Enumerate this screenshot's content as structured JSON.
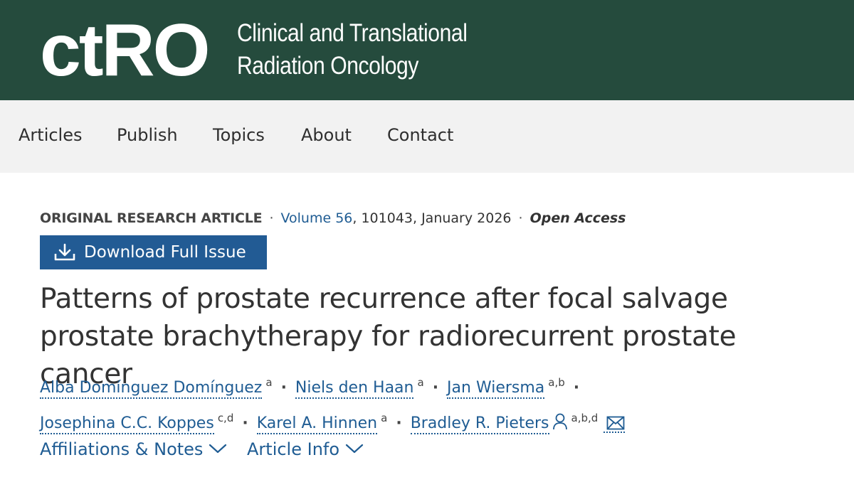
{
  "masthead": {
    "logo": "ctRO",
    "journal_line1": "Clinical and Translational",
    "journal_line2": "Radiation Oncology"
  },
  "nav": {
    "items": [
      "Articles",
      "Publish",
      "Topics",
      "About",
      "Contact"
    ]
  },
  "meta": {
    "article_type": "ORIGINAL RESEARCH ARTICLE",
    "volume_link": "Volume 56",
    "volume_rest": ", 101043, January 2026",
    "access": "Open Access",
    "separator": "·"
  },
  "download": {
    "label": "Download Full Issue",
    "icon": "download-icon"
  },
  "article": {
    "title": "Patterns of prostate recurrence after focal salvage prostate brachytherapy for radiorecurrent prostate cancer"
  },
  "authors": [
    {
      "name": "Alba Domínguez Domínguez",
      "affil": "a"
    },
    {
      "name": "Niels den Haan",
      "affil": "a"
    },
    {
      "name": "Jan Wiersma",
      "affil": "a,b"
    },
    {
      "name": "Josephina C.C. Koppes",
      "affil": "c,d"
    },
    {
      "name": "Karel A. Hinnen",
      "affil": "a"
    },
    {
      "name": "Bradley R. Pieters",
      "affil": "a,b,d",
      "icons": [
        "person-icon",
        "mail-icon"
      ]
    }
  ],
  "expanders": {
    "affiliations": "Affiliations & Notes",
    "article_info": "Article Info"
  },
  "colors": {
    "masthead_bg": "#254b3d",
    "nav_bg": "#f2f2f2",
    "link": "#1f5c93",
    "button_bg": "#225b94"
  }
}
